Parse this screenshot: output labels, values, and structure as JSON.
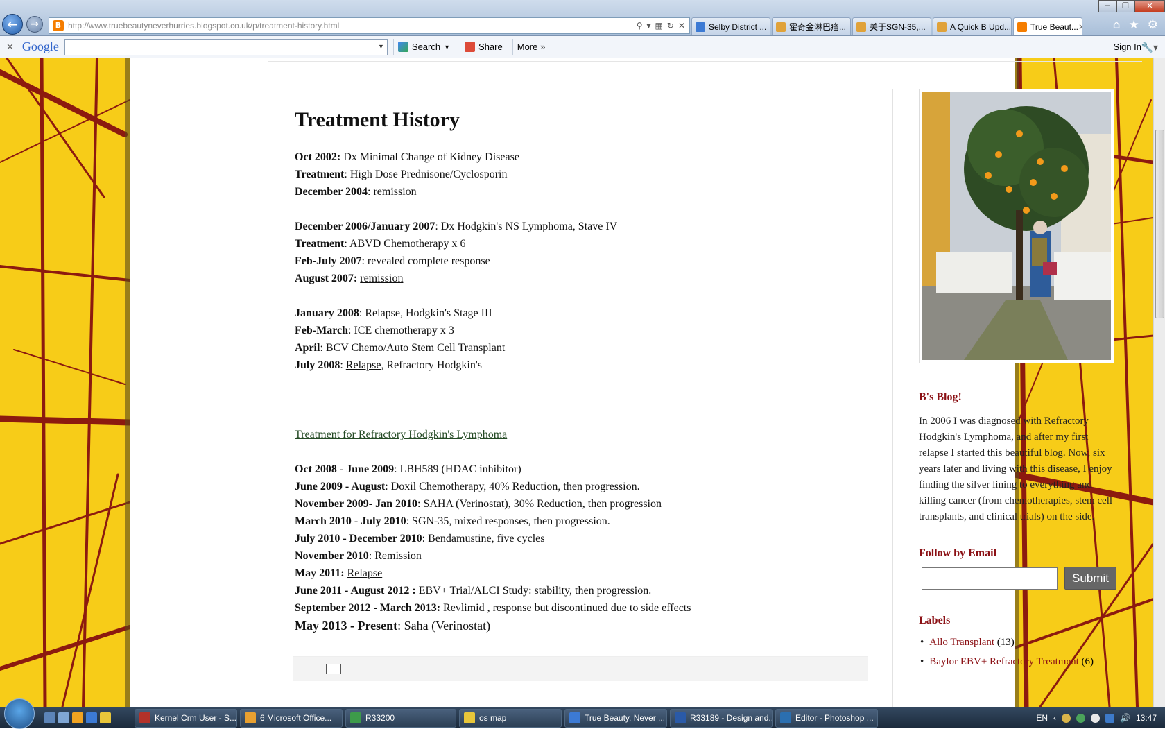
{
  "browser": {
    "url": "http://www.truebeautyneverhurries.blogspot.co.uk/p/treatment-history.html",
    "tabs": [
      {
        "label": "Selby District ...",
        "icon": "ie-icon"
      },
      {
        "label": "霍奇金淋巴瘤...",
        "icon": "page-icon"
      },
      {
        "label": "关于SGN-35,...",
        "icon": "page-icon"
      },
      {
        "label": "A Quick B Upd...",
        "icon": "page-icon"
      },
      {
        "label": "True Beaut...",
        "icon": "blogger-icon",
        "active": true
      }
    ]
  },
  "google_toolbar": {
    "logo": "Google",
    "search_label": "Search",
    "share_label": "Share",
    "more_label": "More »",
    "signin_label": "Sign In"
  },
  "post": {
    "title": "Treatment History",
    "group1": [
      {
        "bold": "Oct 2002:",
        "text": " Dx Minimal Change of Kidney Disease"
      },
      {
        "bold": "Treatment",
        "text": ": High Dose Prednisone/Cyclosporin"
      },
      {
        "bold": "December 2004",
        "text": ": remission"
      }
    ],
    "group2": [
      {
        "bold": "December 2006/January 2007",
        "text": ": Dx Hodgkin's NS Lymphoma, Stave IV"
      },
      {
        "bold": "Treatment",
        "text": ": ABVD Chemotherapy x 6"
      },
      {
        "bold": "Feb-July 2007",
        "text": ": revealed complete response"
      },
      {
        "bold": "August 2007:",
        "link": "remission"
      }
    ],
    "group3": [
      {
        "bold": "January 2008",
        "text": ": Relapse, Hodgkin's Stage III"
      },
      {
        "bold": "Feb-March",
        "text": ": ICE chemotherapy x 3"
      },
      {
        "bold": "April",
        "text": ": BCV Chemo/Auto Stem Cell Transplant"
      },
      {
        "bold": "July 2008",
        "pre": ": ",
        "link": "Relapse",
        "text": ", Refractory Hodgkin's"
      }
    ],
    "refractory_link": "Treatment for Refractory Hodgkin's Lymphoma",
    "group4": [
      {
        "bold": "Oct 2008 - June 2009",
        "text": ": LBH589 (HDAC inhibitor)"
      },
      {
        "bold": "June 2009 - August",
        "text": ": Doxil Chemotherapy, 40% Reduction, then progression."
      },
      {
        "bold": "November 2009- Jan 2010",
        "text": ": SAHA (Verinostat), 30% Reduction, then progression"
      },
      {
        "bold": "March 2010 - July 2010",
        "text": ": SGN-35, mixed responses, then progression."
      },
      {
        "bold": "July 2010 - December 2010",
        "text": ": Bendamustine, five cycles"
      },
      {
        "bold": "November 2010",
        "pre": ": ",
        "link": "Remission"
      },
      {
        "bold": "May 2011:",
        "link": "Relapse "
      },
      {
        "bold": "June 2011 - August 2012 :",
        "text": " EBV+ Trial/ALCI Study: stability, then progression."
      },
      {
        "bold": "September 2012 - March 2013:",
        "text": " Revlimid , response but discontinued due to side effects"
      }
    ],
    "present": {
      "bold": "May 2013 - Present",
      "text": ": Saha (Verinostat)"
    }
  },
  "sidebar": {
    "blog_heading": "B's Blog!",
    "about": "In 2006 I was diagnosed with Refractory Hodgkin's Lymphoma, and after my first relapse I started this beautiful blog. Now, six years later and living with this disease, I enjoy finding the silver lining to everything and killing cancer (from chemotherapies, stem cell transplants, and clinical trials) on the side.",
    "follow_heading": "Follow by Email",
    "submit_label": "Submit",
    "labels_heading": "Labels",
    "labels": [
      {
        "name": "Allo Transplant",
        "count": "(13)"
      },
      {
        "name": "Baylor EBV+ Refractory Treatment",
        "count": "(6)"
      }
    ]
  },
  "taskbar": {
    "tasks": [
      {
        "label": "Kernel Crm User - S...",
        "width": 148
      },
      {
        "label": "6 Microsoft Office...",
        "width": 148
      },
      {
        "label": "R33200",
        "width": 160
      },
      {
        "label": "os map",
        "width": 148
      },
      {
        "label": "True Beauty, Never ...",
        "width": 148
      },
      {
        "label": "R33189 - Design and...",
        "width": 148
      },
      {
        "label": "Editor - Photoshop ...",
        "width": 148
      }
    ],
    "language": "EN",
    "clock": "13:47"
  },
  "colors": {
    "sidebar_heading": "#8b1014",
    "background_yellow": "#f6c81a",
    "link_green": "#244a24"
  }
}
